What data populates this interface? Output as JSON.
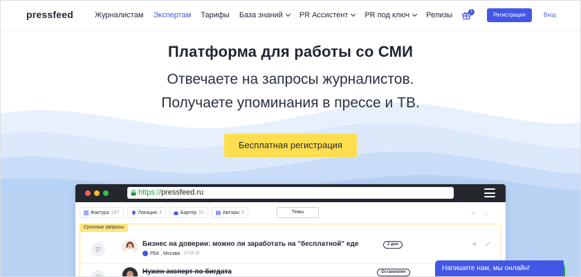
{
  "nav": {
    "logo": "pressfeed",
    "items": [
      {
        "label": "Журналистам",
        "active": false,
        "dropdown": false
      },
      {
        "label": "Экспертам",
        "active": true,
        "dropdown": false
      },
      {
        "label": "Тарифы",
        "active": false,
        "dropdown": false
      },
      {
        "label": "База знаний",
        "active": false,
        "dropdown": true
      },
      {
        "label": "PR Ассистент",
        "active": false,
        "dropdown": true
      },
      {
        "label": "PR под ключ",
        "active": false,
        "dropdown": true
      },
      {
        "label": "Релизы",
        "active": false,
        "dropdown": false
      }
    ],
    "gift_badge": "1",
    "register_label": "Регистрация",
    "login_label": "Вход"
  },
  "hero": {
    "title": "Платформа для работы со СМИ",
    "subtitle_line1": "Отвечаете на запросы журналистов.",
    "subtitle_line2": "Получаете упоминания в прессе и ТВ.",
    "cta_label": "Бесплатная регистрация"
  },
  "browser": {
    "url_scheme": "https://",
    "url_host": "pressfeed.ru",
    "filters": [
      {
        "label": "Фактура",
        "count": "247",
        "icon": "list-icon"
      },
      {
        "label": "Локации",
        "count": "4",
        "icon": "location-pin-icon"
      },
      {
        "label": "Бартер",
        "count": "10",
        "icon": "puzzle-icon"
      },
      {
        "label": "Авторы",
        "count": "9",
        "icon": "author-icon"
      }
    ],
    "themes_label": "Темы",
    "urgent_label": "Срочные запросы",
    "requests": [
      {
        "title": "Бизнес на доверии: можно ли заработать на \"бесплатной\" еде",
        "outlet": "РБК , Москва.",
        "date": "15.04.18",
        "status": "2 дня",
        "strike": false
      },
      {
        "title": "Нужен эксперт по бигдата",
        "status": "Остановлен",
        "strike": true
      }
    ]
  },
  "chat": {
    "label": "Напишите нам, мы онлайн!"
  },
  "colors": {
    "accent": "#4357e6",
    "cta": "#ffdf4f",
    "urgent": "#ffe680",
    "wave_light": "#dce9fb",
    "wave_mid": "#c3daf7"
  }
}
